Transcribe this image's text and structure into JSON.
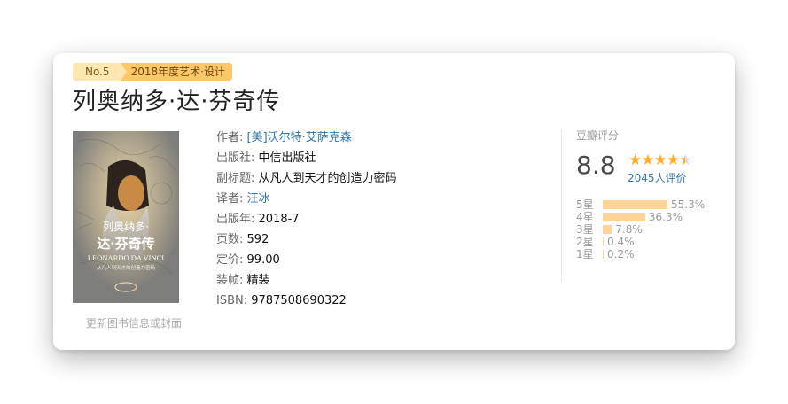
{
  "badge": {
    "rank": "No.5",
    "category": "2018年度艺术·设计"
  },
  "book": {
    "title": "列奥纳多·达·芬奇传",
    "cover": {
      "title_line1": "列奥纳多·",
      "title_line2": "达·芬奇传",
      "title_en": "LEONARDO DA VINCI",
      "subtitle": "从凡人到天才的创造力密码"
    },
    "update_link": "更新图书信息或封面",
    "info": [
      {
        "label": "作者:",
        "value": "[美]沃尔特·艾萨克森",
        "link": true
      },
      {
        "label": "出版社:",
        "value": "中信出版社",
        "link": false
      },
      {
        "label": "副标题:",
        "value": "从凡人到天才的创造力密码",
        "link": false
      },
      {
        "label": "译者:",
        "value": "汪冰",
        "link": true
      },
      {
        "label": "出版年:",
        "value": "2018-7",
        "link": false
      },
      {
        "label": "页数:",
        "value": "592",
        "link": false
      },
      {
        "label": "定价:",
        "value": "99.00",
        "link": false
      },
      {
        "label": "装帧:",
        "value": "精装",
        "link": false
      },
      {
        "label": "ISBN:",
        "value": "9787508690322",
        "link": false
      }
    ]
  },
  "rating": {
    "title": "豆瓣评分",
    "score": "8.8",
    "stars": 4.5,
    "votes": "2045人评价",
    "distribution": [
      {
        "label": "5星",
        "percent": 55.3,
        "text": "55.3%"
      },
      {
        "label": "4星",
        "percent": 36.3,
        "text": "36.3%"
      },
      {
        "label": "3星",
        "percent": 7.8,
        "text": "7.8%"
      },
      {
        "label": "2星",
        "percent": 0.4,
        "text": "0.4%"
      },
      {
        "label": "1星",
        "percent": 0.2,
        "text": "0.2%"
      }
    ],
    "colors": {
      "star": "#ffac2d",
      "bar": "#ffd596",
      "link": "#3377aa"
    }
  }
}
